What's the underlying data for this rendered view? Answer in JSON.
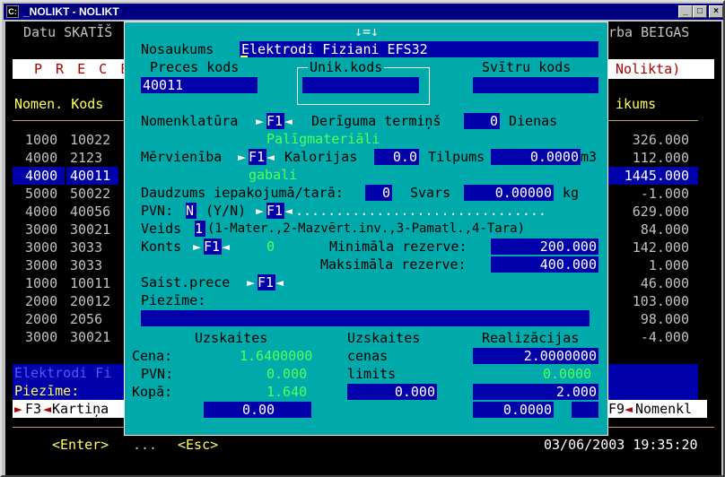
{
  "window": {
    "title": "_NOLIKT - NOLIKT",
    "icon": "dos-icon",
    "buttons": [
      "minimize",
      "maximize",
      "close"
    ]
  },
  "menu": {
    "left": "Datu SKATĪŠ",
    "right": "rba BEIGAS"
  },
  "header": {
    "left": "P R E C E",
    "right": "Nolikta)"
  },
  "columns": {
    "left": "Nomen. Kods",
    "right": "ikums"
  },
  "rows": [
    {
      "nom": "1000",
      "kods": "10022",
      "val": "326.000"
    },
    {
      "nom": "4000",
      "kods": "2123",
      "val": "112.000"
    },
    {
      "nom": "4000",
      "kods": "40011",
      "val": "1445.000"
    },
    {
      "nom": "5000",
      "kods": "50022",
      "val": "-1.000"
    },
    {
      "nom": "4000",
      "kods": "40056",
      "val": "629.000"
    },
    {
      "nom": "3000",
      "kods": "30021",
      "val": "84.000"
    },
    {
      "nom": "3000",
      "kods": "3033",
      "val": "142.000"
    },
    {
      "nom": "3000",
      "kods": "3033",
      "val": "1.000"
    },
    {
      "nom": "1000",
      "kods": "10011",
      "val": "46.000"
    },
    {
      "nom": "2000",
      "kods": "20012",
      "val": "103.000"
    },
    {
      "nom": "2000",
      "kods": "2056",
      "val": "98.000"
    },
    {
      "nom": "3000",
      "kods": "30021",
      "val": "-4.000"
    }
  ],
  "bottom": {
    "name_frag": "Elektrodi Fi",
    "piezime_label": "Piezīme:",
    "f3": "F3",
    "kartina": "Kartiņa",
    "f9": "F9",
    "nomenkl": "Nomenkl",
    "enter": "<Enter>",
    "dots": "...",
    "esc": "<Esc>",
    "datetime": "03/06/2003 19:35:20"
  },
  "dialog": {
    "top_marker": "↓=↓",
    "nosaukums_label": "Nosaukums",
    "nosaukums_value": "Elektrodi Fiziani EFS32",
    "preces_kods_label": "Preces kods",
    "preces_kods_value": "40011",
    "unik_kods_label": "Unik.kods",
    "unik_kods_value": "",
    "svitru_kods_label": "Svītru kods",
    "svitru_kods_value": "",
    "nomenklatura_label": "Nomenklatūra",
    "f1": "F1",
    "deriguma_label": "Derīguma termiņš",
    "deriguma_value": "0",
    "dienas": "Dienas",
    "nomenklatura_text": "Palīgmateriāli",
    "mervieniba_label": "Mērvienība",
    "kalorijas_label": "Kalorijas",
    "kalorijas_value": "0.0",
    "tilpums_label": "Tilpums",
    "tilpums_value": "0.0000",
    "m3": "m3",
    "mervieniba_text": "gabali",
    "daudzums_label": "Daudzums iepakojumā/tarā:",
    "daudzums_value": "0",
    "svars_label": "Svars",
    "svars_value": "0.00000",
    "kg": "kg",
    "pvn_label": "PVN:",
    "pvn_value": "N",
    "pvn_hint": "(Y/N)",
    "pvn_dots": "...............................",
    "veids_label": "Veids",
    "veids_value": "1",
    "veids_hint": "(1-Mater.,2-Mazvērt.inv.,3-Pamatl.,4-Tara)",
    "konts_label": "Konts",
    "konts_value": "0",
    "min_label": "Minimāla rezerve:",
    "min_value": "200.000",
    "max_label": "Maksimāla rezerve:",
    "max_value": "400.000",
    "saist_label": "Saist.prece",
    "piezime_label": "Piezīme:",
    "uzskaites1": "Uzskaites",
    "uzskaites2": "Uzskaites",
    "realizacijas": "Realizācijas",
    "cena_label": "Cena:",
    "cena_value": "1.6400000",
    "cenas_label": "cenas",
    "real_cena": "2.0000000",
    "pvn2_label": "PVN:",
    "pvn2_value": "0.000",
    "limits_label": "limits",
    "limits_value": "0.0000",
    "kopa_label": "Kopā:",
    "kopa_value": "1.640",
    "kopa_mid": "0.000",
    "kopa_real": "2.000",
    "bottom_left": "0.00",
    "bottom_right": "0.0000"
  }
}
